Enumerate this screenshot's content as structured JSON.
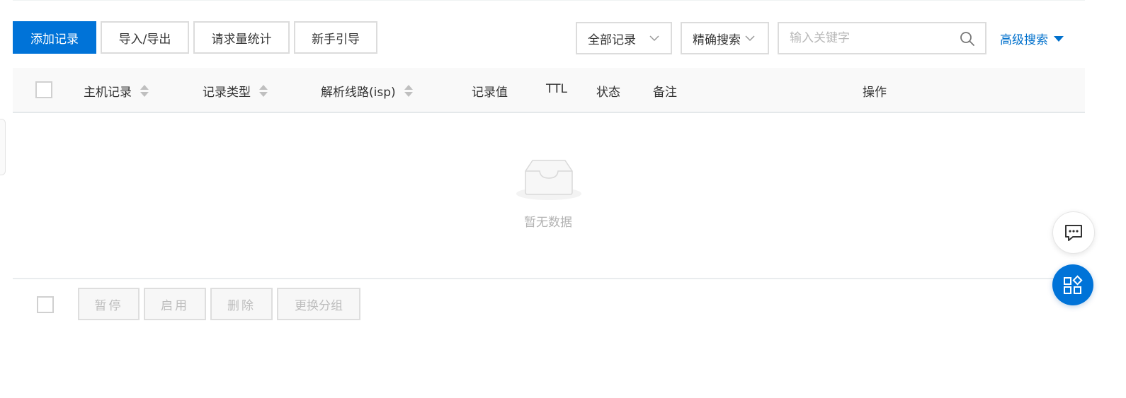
{
  "toolbar": {
    "add_record": "添加记录",
    "import_export": "导入/导出",
    "request_stats": "请求量统计",
    "beginner_guide": "新手引导",
    "record_filter": "全部记录",
    "search_mode": "精确搜索",
    "search_placeholder": "输入关键字",
    "advanced_search": "高级搜索"
  },
  "table": {
    "columns": {
      "host": "主机记录",
      "type": "记录类型",
      "line": "解析线路(isp)",
      "value": "记录值",
      "ttl": "TTL",
      "status": "状态",
      "remark": "备注",
      "actions": "操作"
    },
    "empty_text": "暂无数据"
  },
  "batch": {
    "pause": "暂停",
    "enable": "启用",
    "delete": "删除",
    "change_group": "更换分组"
  },
  "colors": {
    "primary": "#0073d8",
    "link": "#0070cc",
    "border": "#dcdcdc",
    "header_bg": "#f9f9f9",
    "disabled_text": "#bdbdbd"
  },
  "icons": {
    "search": "search-icon",
    "chevron": "chevron-down-icon",
    "sort": "sort-icon",
    "empty": "empty-inbox-icon",
    "chat": "chat-icon",
    "apps": "apps-icon"
  }
}
